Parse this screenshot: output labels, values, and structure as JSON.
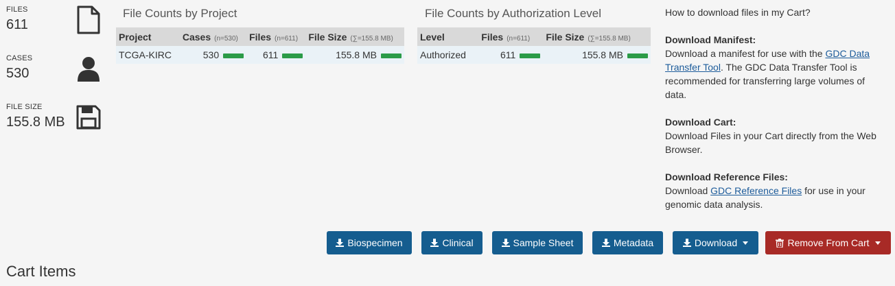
{
  "summary": {
    "files": {
      "label": "FILES",
      "value": "611",
      "icon": "file-icon"
    },
    "cases": {
      "label": "CASES",
      "value": "530",
      "icon": "user-icon"
    },
    "file_size": {
      "label": "FILE SIZE",
      "value": "155.8 MB",
      "icon": "save-icon"
    }
  },
  "project_table": {
    "title": "File Counts by Project",
    "headers": {
      "project": "Project",
      "cases": "Cases",
      "cases_n": "(n=530)",
      "files": "Files",
      "files_n": "(n=611)",
      "size": "File Size",
      "size_n": "(∑=155.8 MB)"
    },
    "rows": [
      {
        "project": "TCGA-KIRC",
        "cases": "530",
        "files": "611",
        "size": "155.8 MB"
      }
    ]
  },
  "auth_table": {
    "title": "File Counts by Authorization Level",
    "headers": {
      "level": "Level",
      "files": "Files",
      "files_n": "(n=611)",
      "size": "File Size",
      "size_n": "(∑=155.8 MB)"
    },
    "rows": [
      {
        "level": "Authorized",
        "files": "611",
        "size": "155.8 MB"
      }
    ]
  },
  "help": {
    "title": "How to download files in my Cart?",
    "manifest_heading": "Download Manifest:",
    "manifest_text_1": "Download a manifest for use with the ",
    "manifest_link": "GDC Data Transfer Tool",
    "manifest_text_2": ". The GDC Data Transfer Tool is recommended for transferring large volumes of data.",
    "cart_heading": "Download Cart:",
    "cart_text": "Download Files in your Cart directly from the Web Browser.",
    "ref_heading": "Download Reference Files:",
    "ref_text_1": "Download ",
    "ref_link": "GDC Reference Files",
    "ref_text_2": " for use in your genomic data analysis."
  },
  "buttons": {
    "biospecimen": "Biospecimen",
    "clinical": "Clinical",
    "sample_sheet": "Sample Sheet",
    "metadata": "Metadata",
    "download": "Download",
    "remove": "Remove From Cart"
  },
  "cart_items_title": "Cart Items",
  "colors": {
    "primary": "#155d8f",
    "danger": "#a82a26",
    "bar": "#2b9b48"
  }
}
